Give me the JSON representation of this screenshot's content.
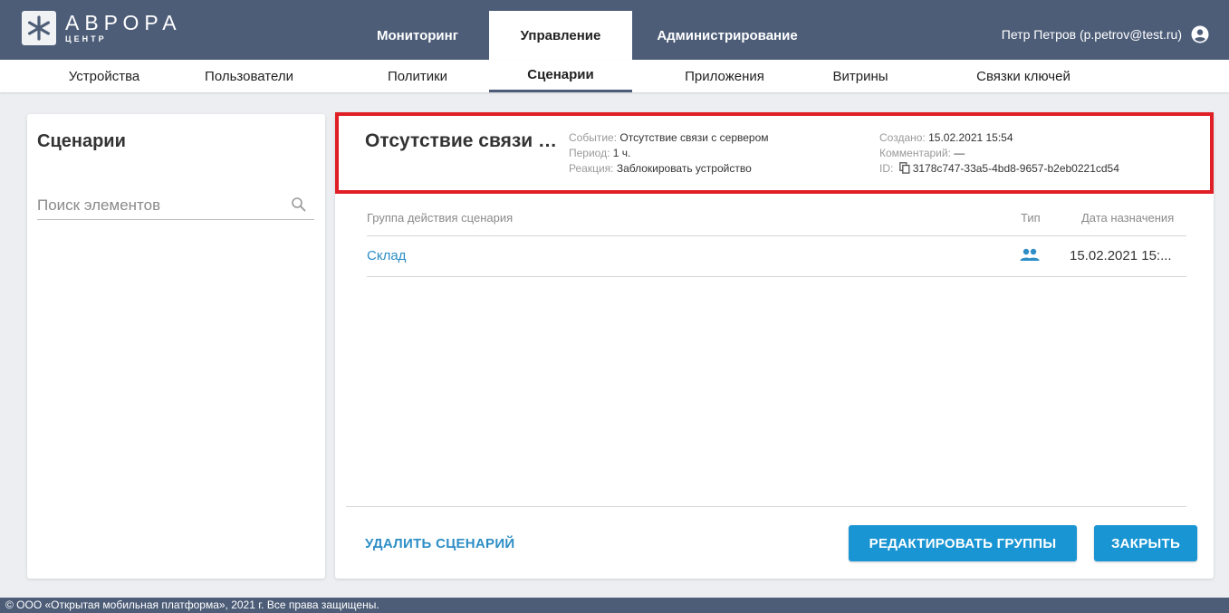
{
  "brand": {
    "name": "АВРОРА",
    "subtitle": "ЦЕНТР"
  },
  "main_tabs": [
    {
      "label": "Мониторинг",
      "active": false
    },
    {
      "label": "Управление",
      "active": true
    },
    {
      "label": "Администрирование",
      "active": false
    }
  ],
  "user": {
    "label": "Петр Петров (p.petrov@test.ru)",
    "icon": "account-circle-icon"
  },
  "sub_nav": [
    {
      "label": "Устройства",
      "active": false
    },
    {
      "label": "Пользователи",
      "active": false
    },
    {
      "label": "Политики",
      "active": false
    },
    {
      "label": "Сценарии",
      "active": true
    },
    {
      "label": "Приложения",
      "active": false
    },
    {
      "label": "Витрины",
      "active": false
    },
    {
      "label": "Связки ключей",
      "active": false
    }
  ],
  "left_panel": {
    "title": "Сценарии",
    "search_placeholder": "Поиск элементов",
    "search_icon": "search-icon"
  },
  "scenario": {
    "title": "Отсутствие связи с сервером",
    "event_label": "Событие:",
    "event_value": "Отсутствие связи с сервером",
    "period_label": "Период:",
    "period_value": "1 ч.",
    "reaction_label": "Реакция:",
    "reaction_value": "Заблокировать устройство",
    "created_label": "Создано:",
    "created_value": "15.02.2021 15:54",
    "comment_label": "Комментарий:",
    "comment_value": "—",
    "id_label": "ID:",
    "id_value": "3178c747-33a5-4bd8-9657-b2eb0221cd54",
    "highlight_color": "#e01e26"
  },
  "table": {
    "columns": [
      "Группа действия сценария",
      "Тип",
      "Дата назначения"
    ],
    "rows": [
      {
        "group": "Склад",
        "type_icon": "group-icon",
        "date": "15.02.2021 15:..."
      }
    ]
  },
  "actions": {
    "delete": "УДАЛИТЬ СЦЕНАРИЙ",
    "edit_groups": "РЕДАКТИРОВАТЬ ГРУППЫ",
    "close": "ЗАКРЫТЬ"
  },
  "footer": {
    "text": "© ООО «Открытая мобильная платформа», 2021 г. Все права защищены."
  },
  "colors": {
    "header": "#4d5d78",
    "accent": "#1a95d3",
    "link": "#2d8ec6",
    "background": "#eceef1"
  }
}
